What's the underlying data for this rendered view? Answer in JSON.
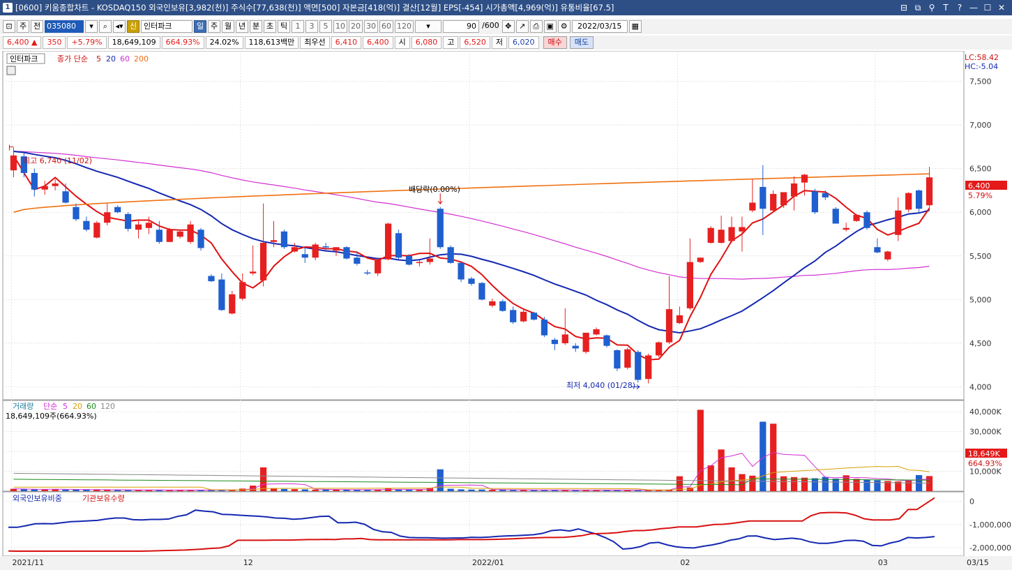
{
  "window": {
    "badge": "1",
    "title": "[0600] 키움종합차트 - KOSDAQ150 외국인보유[3,982(천)] 주식수[77,638(천)] 액면[500] 자본금[418(억)] 결산[12월] EPS[-454] 시가총액[4,969(억)] 유통비율[67.5]",
    "buttons": [
      "⊟",
      "⧉",
      "⚲",
      "T",
      "?",
      "—",
      "☐",
      "✕"
    ]
  },
  "toolbar": {
    "period_combo": "주",
    "prev_button": "전",
    "stock_code": "035080",
    "credit_badge": "신",
    "stock_name": "인터파크",
    "period_tabs": [
      "일",
      "주",
      "월",
      "년",
      "분",
      "초",
      "틱"
    ],
    "selected_tab": "일",
    "interval_buttons": [
      "1",
      "3",
      "5",
      "10",
      "20",
      "30",
      "60",
      "120"
    ],
    "count_value": "90",
    "count_total": "/600",
    "date_value": "2022/03/15"
  },
  "quote": {
    "price": "6,400",
    "change_arrow": "▲",
    "change": "350",
    "change_pct": "+5.79%",
    "volume": "18,649,109",
    "volume_pct": "664.93%",
    "turnover": "24.02%",
    "amount": "118,613백만",
    "preferred_label": "최우선",
    "ask": "6,410",
    "bid": "6,400",
    "open_label": "시",
    "open": "6,080",
    "high_label": "고",
    "high": "6,520",
    "low_label": "저",
    "low": "6,020",
    "buy_button": "매수",
    "sell_button": "매도"
  },
  "price_panel": {
    "legend_name": "인터파크",
    "legend_ma_label": "종가 단순",
    "ma_periods": [
      "5",
      "20",
      "60",
      "200"
    ],
    "lc_label": "LC:58.42",
    "hc_label": "HC:-5.04",
    "y_ticks": [
      "7,500",
      "7,000",
      "6,500",
      "6,000",
      "5,500",
      "5,000",
      "4,500",
      "4,000"
    ],
    "current_price_tag": "6,400",
    "current_change_tag": "5.79%",
    "high_annotation": "최고 6,740 (11/02)",
    "low_annotation": "최저 4,040 (01/28)",
    "dividend_annotation": "배당락(0.00%)"
  },
  "volume_panel": {
    "legend_name": "거래량",
    "legend_ma_label": "단순",
    "ma_periods": [
      "5",
      "20",
      "60",
      "120"
    ],
    "current_volume_text": "18,649,109주(664.93%)",
    "y_ticks": [
      "40,000K",
      "30,000K",
      "20,000K",
      "10,000K"
    ],
    "current_tag": "18,649K",
    "current_pct_tag": "664.93%"
  },
  "holding_panel": {
    "legend_foreign": "외국인보유비중",
    "legend_inst": "기관보유수량",
    "y_ticks": [
      "0",
      "-1,000,000",
      "-2,000,000"
    ]
  },
  "x_axis": {
    "labels": [
      "2021/11",
      "12",
      "2022/01",
      "02",
      "03",
      "03/15"
    ]
  },
  "colors": {
    "up": "#e62020",
    "down": "#1f5fcf",
    "ma5": "#e01010",
    "ma20": "#1428b0",
    "ma60": "#d22fd2",
    "ma200": "#f07010",
    "title_bar": "#2e4f86"
  },
  "chart_data": {
    "type": "candlestick",
    "title": "인터파크",
    "x_start": "2021-11-01",
    "x_end": "2022-03-15",
    "ylim": [
      3900,
      7800
    ],
    "candles": [
      {
        "o": 6480,
        "h": 6740,
        "l": 6400,
        "c": 6650
      },
      {
        "o": 6640,
        "h": 6680,
        "l": 6400,
        "c": 6450
      },
      {
        "o": 6450,
        "h": 6500,
        "l": 6180,
        "c": 6260
      },
      {
        "o": 6260,
        "h": 6360,
        "l": 6200,
        "c": 6300
      },
      {
        "o": 6300,
        "h": 6380,
        "l": 6250,
        "c": 6330
      },
      {
        "o": 6240,
        "h": 6330,
        "l": 6100,
        "c": 6110
      },
      {
        "o": 6060,
        "h": 6100,
        "l": 5900,
        "c": 5920
      },
      {
        "o": 5900,
        "h": 5950,
        "l": 5780,
        "c": 5800
      },
      {
        "o": 5710,
        "h": 5900,
        "l": 5700,
        "c": 5880
      },
      {
        "o": 5880,
        "h": 6100,
        "l": 5850,
        "c": 6000
      },
      {
        "o": 6060,
        "h": 6080,
        "l": 5990,
        "c": 6000
      },
      {
        "o": 5980,
        "h": 6000,
        "l": 5780,
        "c": 5810
      },
      {
        "o": 5800,
        "h": 5900,
        "l": 5700,
        "c": 5860
      },
      {
        "o": 5820,
        "h": 5950,
        "l": 5750,
        "c": 5880
      },
      {
        "o": 5800,
        "h": 5900,
        "l": 5640,
        "c": 5660
      },
      {
        "o": 5660,
        "h": 5820,
        "l": 5660,
        "c": 5800
      },
      {
        "o": 5720,
        "h": 5800,
        "l": 5700,
        "c": 5780
      },
      {
        "o": 5660,
        "h": 5900,
        "l": 5640,
        "c": 5860
      },
      {
        "o": 5800,
        "h": 5820,
        "l": 5560,
        "c": 5590
      },
      {
        "o": 5270,
        "h": 5290,
        "l": 5200,
        "c": 5210
      },
      {
        "o": 5230,
        "h": 5300,
        "l": 4870,
        "c": 4880
      },
      {
        "o": 4840,
        "h": 5100,
        "l": 4830,
        "c": 5060
      },
      {
        "o": 5010,
        "h": 5300,
        "l": 4990,
        "c": 5200
      },
      {
        "o": 5300,
        "h": 5620,
        "l": 5280,
        "c": 5320
      },
      {
        "o": 5220,
        "h": 6100,
        "l": 5150,
        "c": 5650
      },
      {
        "o": 5660,
        "h": 5900,
        "l": 5600,
        "c": 5680
      },
      {
        "o": 5780,
        "h": 5800,
        "l": 5580,
        "c": 5600
      },
      {
        "o": 5550,
        "h": 5650,
        "l": 5540,
        "c": 5600
      },
      {
        "o": 5520,
        "h": 5600,
        "l": 5420,
        "c": 5480
      },
      {
        "o": 5480,
        "h": 5650,
        "l": 5450,
        "c": 5630
      },
      {
        "o": 5610,
        "h": 5650,
        "l": 5560,
        "c": 5600
      },
      {
        "o": 5560,
        "h": 5600,
        "l": 5500,
        "c": 5600
      },
      {
        "o": 5600,
        "h": 5610,
        "l": 5460,
        "c": 5470
      },
      {
        "o": 5480,
        "h": 5550,
        "l": 5390,
        "c": 5410
      },
      {
        "o": 5310,
        "h": 5340,
        "l": 5280,
        "c": 5300
      },
      {
        "o": 5300,
        "h": 5480,
        "l": 5270,
        "c": 5460
      },
      {
        "o": 5460,
        "h": 5880,
        "l": 5450,
        "c": 5870
      },
      {
        "o": 5760,
        "h": 5800,
        "l": 5460,
        "c": 5480
      },
      {
        "o": 5500,
        "h": 5520,
        "l": 5390,
        "c": 5400
      },
      {
        "o": 5420,
        "h": 5450,
        "l": 5380,
        "c": 5430
      },
      {
        "o": 5430,
        "h": 5700,
        "l": 5400,
        "c": 5470
      },
      {
        "o": 6040,
        "h": 6060,
        "l": 5580,
        "c": 5600
      },
      {
        "o": 5600,
        "h": 5620,
        "l": 5410,
        "c": 5420
      },
      {
        "o": 5420,
        "h": 5430,
        "l": 5200,
        "c": 5230
      },
      {
        "o": 5240,
        "h": 5260,
        "l": 5160,
        "c": 5180
      },
      {
        "o": 5190,
        "h": 5200,
        "l": 4990,
        "c": 5000
      },
      {
        "o": 4930,
        "h": 5010,
        "l": 4910,
        "c": 4980
      },
      {
        "o": 4980,
        "h": 5000,
        "l": 4860,
        "c": 4870
      },
      {
        "o": 4880,
        "h": 4920,
        "l": 4720,
        "c": 4740
      },
      {
        "o": 4750,
        "h": 4880,
        "l": 4740,
        "c": 4860
      },
      {
        "o": 4850,
        "h": 4860,
        "l": 4760,
        "c": 4770
      },
      {
        "o": 4770,
        "h": 4800,
        "l": 4570,
        "c": 4590
      },
      {
        "o": 4540,
        "h": 4560,
        "l": 4420,
        "c": 4490
      },
      {
        "o": 4500,
        "h": 4900,
        "l": 4480,
        "c": 4600
      },
      {
        "o": 4470,
        "h": 4500,
        "l": 4400,
        "c": 4440
      },
      {
        "o": 4400,
        "h": 4600,
        "l": 4380,
        "c": 4620
      },
      {
        "o": 4600,
        "h": 4680,
        "l": 4590,
        "c": 4660
      },
      {
        "o": 4590,
        "h": 4600,
        "l": 4450,
        "c": 4470
      },
      {
        "o": 4420,
        "h": 4430,
        "l": 4180,
        "c": 4210
      },
      {
        "o": 4220,
        "h": 4450,
        "l": 4200,
        "c": 4430
      },
      {
        "o": 4400,
        "h": 4420,
        "l": 4050,
        "c": 4080
      },
      {
        "o": 4090,
        "h": 4380,
        "l": 4040,
        "c": 4360
      },
      {
        "o": 4360,
        "h": 4520,
        "l": 4340,
        "c": 4510
      },
      {
        "o": 4510,
        "h": 5270,
        "l": 4490,
        "c": 4890
      },
      {
        "o": 4730,
        "h": 4920,
        "l": 4720,
        "c": 4820
      },
      {
        "o": 4900,
        "h": 5700,
        "l": 4880,
        "c": 5430
      },
      {
        "o": 5430,
        "h": 5480,
        "l": 5420,
        "c": 5480
      },
      {
        "o": 5650,
        "h": 5840,
        "l": 5640,
        "c": 5820
      },
      {
        "o": 5650,
        "h": 5960,
        "l": 5640,
        "c": 5800
      },
      {
        "o": 5670,
        "h": 5950,
        "l": 5650,
        "c": 5830
      },
      {
        "o": 5780,
        "h": 5950,
        "l": 5550,
        "c": 5830
      },
      {
        "o": 6020,
        "h": 6380,
        "l": 6000,
        "c": 6110
      },
      {
        "o": 6290,
        "h": 6540,
        "l": 5740,
        "c": 6040
      },
      {
        "o": 6020,
        "h": 6250,
        "l": 6000,
        "c": 6210
      },
      {
        "o": 6080,
        "h": 6230,
        "l": 6050,
        "c": 6230
      },
      {
        "o": 6180,
        "h": 6410,
        "l": 6020,
        "c": 6330
      },
      {
        "o": 6340,
        "h": 6440,
        "l": 6190,
        "c": 6430
      },
      {
        "o": 6240,
        "h": 6270,
        "l": 5980,
        "c": 6000
      },
      {
        "o": 6220,
        "h": 6250,
        "l": 6140,
        "c": 6170
      },
      {
        "o": 6040,
        "h": 6060,
        "l": 5880,
        "c": 5870
      },
      {
        "o": 5800,
        "h": 5880,
        "l": 5780,
        "c": 5820
      },
      {
        "o": 5900,
        "h": 5980,
        "l": 5890,
        "c": 5970
      },
      {
        "o": 6000,
        "h": 6020,
        "l": 5800,
        "c": 5820
      },
      {
        "o": 5600,
        "h": 5700,
        "l": 5530,
        "c": 5540
      },
      {
        "o": 5460,
        "h": 5560,
        "l": 5440,
        "c": 5550
      },
      {
        "o": 5740,
        "h": 6170,
        "l": 5670,
        "c": 6020
      },
      {
        "o": 6030,
        "h": 6230,
        "l": 6000,
        "c": 6220
      },
      {
        "o": 6250,
        "h": 6260,
        "l": 6000,
        "c": 6040
      },
      {
        "o": 6080,
        "h": 6520,
        "l": 6020,
        "c": 6400
      }
    ],
    "volume_k": [
      1200,
      1100,
      1000,
      900,
      950,
      800,
      800,
      700,
      700,
      650,
      650,
      600,
      600,
      550,
      600,
      550,
      550,
      600,
      550,
      550,
      600,
      700,
      1300,
      2800,
      12000,
      1500,
      1100,
      1000,
      900,
      800,
      800,
      700,
      700,
      750,
      700,
      800,
      1500,
      800,
      700,
      650,
      1400,
      11000,
      1200,
      900,
      800,
      800,
      700,
      700,
      600,
      650,
      600,
      600,
      550,
      600,
      550,
      550,
      600,
      550,
      550,
      600,
      550,
      650,
      550,
      700,
      7500,
      1800,
      41000,
      13000,
      21000,
      12000,
      8600,
      7800,
      35000,
      34000,
      7500,
      7100,
      6800,
      6500,
      7200,
      6300,
      8000,
      6200,
      5900,
      5500,
      5100,
      4900,
      5200,
      8100,
      7600,
      5400,
      18649
    ],
    "series": [
      {
        "name": "외국인보유비중",
        "values": [
          -1120000,
          -1120000,
          -1050000,
          -970000,
          -960000,
          -970000,
          -920000,
          -880000,
          -860000,
          -840000,
          -820000,
          -760000,
          -720000,
          -720000,
          -790000,
          -800000,
          -780000,
          -780000,
          -760000,
          -650000,
          -580000,
          -380000,
          -420000,
          -450000,
          -560000,
          -570000,
          -600000,
          -620000,
          -640000,
          -670000,
          -720000,
          -730000,
          -770000,
          -750000,
          -700000,
          -650000,
          -640000,
          -920000,
          -920000,
          -900000,
          -990000,
          -1210000,
          -1310000,
          -1340000,
          -1500000,
          -1560000,
          -1570000,
          -1570000,
          -1580000,
          -1590000,
          -1580000,
          -1580000,
          -1550000,
          -1560000,
          -1540000,
          -1510000,
          -1490000,
          -1480000,
          -1460000,
          -1440000,
          -1380000,
          -1260000,
          -1230000,
          -1280000,
          -1190000,
          -1300000,
          -1410000,
          -1560000,
          -1750000,
          -2060000,
          -2030000,
          -1950000,
          -1800000,
          -1770000,
          -1880000,
          -1960000,
          -2000000,
          -2010000,
          -1940000,
          -1880000,
          -1800000,
          -1680000,
          -1620000,
          -1500000,
          -1490000,
          -1580000,
          -1650000,
          -1620000,
          -1590000,
          -1630000,
          -1750000,
          -1810000,
          -1810000,
          -1760000,
          -1690000,
          -1680000,
          -1720000,
          -1900000,
          -1920000,
          -1800000,
          -1720000,
          -1560000,
          -1580000,
          -1560000,
          -1520000
        ],
        "x_count": 90
      },
      {
        "name": "기관보유수량",
        "values": [
          -2140000,
          -2150000,
          -2150000,
          -2150000,
          -2150000,
          -2150000,
          -2150000,
          -2150000,
          -2150000,
          -2150000,
          -2150000,
          -2150000,
          -2150000,
          -2150000,
          -2150000,
          -2150000,
          -2140000,
          -2130000,
          -2120000,
          -2110000,
          -2100000,
          -2080000,
          -2060000,
          -2030000,
          -2010000,
          -1920000,
          -1680000,
          -1680000,
          -1680000,
          -1680000,
          -1670000,
          -1670000,
          -1670000,
          -1660000,
          -1650000,
          -1650000,
          -1640000,
          -1650000,
          -1620000,
          -1620000,
          -1600000,
          -1650000,
          -1660000,
          -1660000,
          -1660000,
          -1660000,
          -1660000,
          -1660000,
          -1660000,
          -1660000,
          -1660000,
          -1650000,
          -1650000,
          -1650000,
          -1650000,
          -1640000,
          -1630000,
          -1620000,
          -1600000,
          -1580000,
          -1570000,
          -1560000,
          -1560000,
          -1550000,
          -1520000,
          -1480000,
          -1400000,
          -1390000,
          -1380000,
          -1350000,
          -1300000,
          -1260000,
          -1260000,
          -1230000,
          -1180000,
          -1150000,
          -1100000,
          -1100000,
          -1100000,
          -1050000,
          -1000000,
          -990000,
          -950000,
          -900000,
          -850000,
          -850000,
          -850000,
          -850000,
          -850000,
          -850000,
          -850000,
          -620000,
          -500000,
          -480000,
          -480000,
          -500000,
          -600000,
          -750000,
          -800000,
          -800000,
          -800000,
          -750000,
          -350000,
          -350000,
          -100000,
          150000
        ],
        "x_count": 90
      }
    ]
  }
}
